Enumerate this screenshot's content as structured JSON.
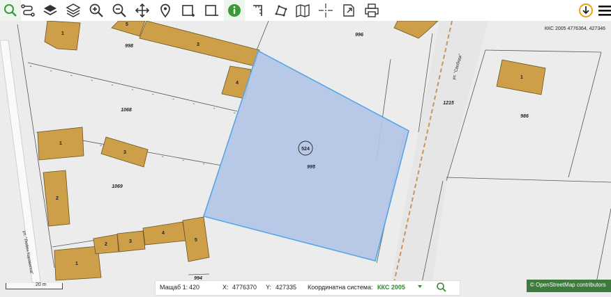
{
  "toolbar": {
    "tools": [
      {
        "name": "search-tool",
        "icon": "magnifier-icon"
      },
      {
        "name": "route-tool",
        "icon": "route-icon"
      },
      {
        "name": "layers-tool",
        "icon": "layers-icon"
      },
      {
        "name": "layers-stack-tool",
        "icon": "layers-stack-icon"
      },
      {
        "name": "zoom-in-tool",
        "icon": "zoom-in-icon"
      },
      {
        "name": "zoom-out-tool",
        "icon": "zoom-out-icon"
      },
      {
        "name": "pan-tool",
        "icon": "pan-icon"
      },
      {
        "name": "location-tool",
        "icon": "location-pin-icon"
      },
      {
        "name": "select-rect-tool",
        "icon": "rectangle-select-icon"
      },
      {
        "name": "select-rect-minus-tool",
        "icon": "rectangle-deselect-icon"
      },
      {
        "name": "info-tool",
        "icon": "info-icon"
      },
      {
        "name": "measure-length-tool",
        "icon": "measure-length-icon"
      },
      {
        "name": "measure-area-tool",
        "icon": "measure-area-icon"
      },
      {
        "name": "map-tool",
        "icon": "map-icon"
      },
      {
        "name": "coordinates-tool",
        "icon": "crosshair-icon"
      },
      {
        "name": "export-tool",
        "icon": "export-icon"
      },
      {
        "name": "print-tool",
        "icon": "print-icon"
      }
    ],
    "right_tools": [
      {
        "name": "download-tool",
        "icon": "download-icon"
      },
      {
        "name": "menu-tool",
        "icon": "hamburger-menu-icon"
      }
    ]
  },
  "map": {
    "coordinate_display": "ККС 2005 4776364, 427346",
    "parcel_labels": [
      "998",
      "996",
      "1068",
      "1215",
      "986",
      "995",
      "1069",
      "994"
    ],
    "selected_parcel_id": "524",
    "selected_parcel_number": "995",
    "building_labels": [
      "1",
      "5",
      "3",
      "4",
      "1",
      "3",
      "1",
      "2",
      "3",
      "4",
      "2",
      "1",
      "5"
    ],
    "street_labels": [
      "ул. \"Свобода\"",
      "ул. \"Любен Каравелов\""
    ],
    "colors": {
      "building": "#cc9f48",
      "selection_fill": "#b3c5e8",
      "selection_stroke": "#55a6e6",
      "background": "#ececec"
    }
  },
  "statusbar": {
    "scale_label": "Мащаб 1:",
    "scale_value": "420",
    "x_label": "X:",
    "x_value": "4776370",
    "y_label": "Y:",
    "y_value": "427335",
    "system_label": "Координатна система:",
    "system_value": "ККС 2005"
  },
  "scalebar": {
    "label": "20 m"
  },
  "attribution": {
    "text": "© OpenStreetMap contributors"
  }
}
